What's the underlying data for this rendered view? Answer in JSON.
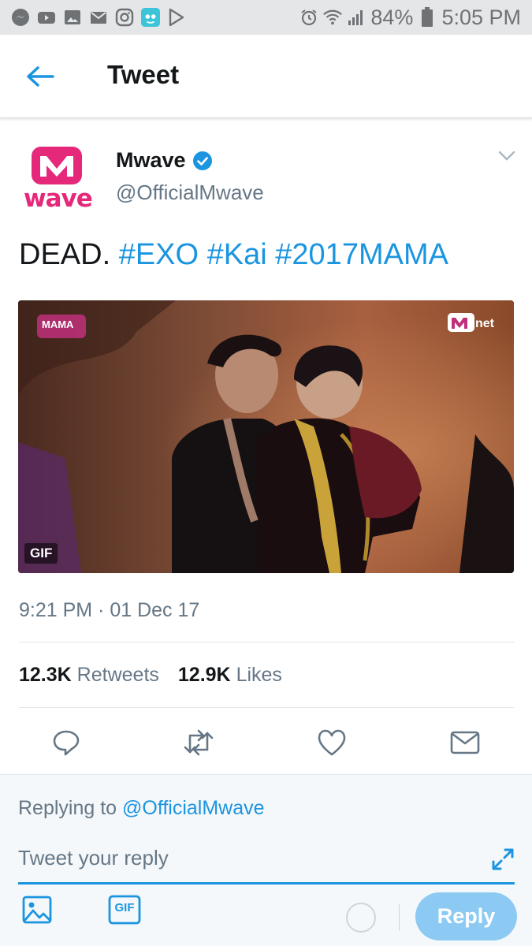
{
  "status_bar": {
    "battery": "84%",
    "time": "5:05 PM",
    "left_icons": [
      "messenger-icon",
      "youtube-icon",
      "gallery-icon",
      "mail-icon",
      "instagram-icon",
      "app-icon",
      "play-store-icon"
    ],
    "right_icons": [
      "alarm-icon",
      "wifi-icon",
      "signal-icon",
      "battery-icon"
    ]
  },
  "header": {
    "title": "Tweet",
    "back_icon": "back-arrow-icon"
  },
  "tweet": {
    "author_name": "Mwave",
    "author_handle": "@OfficialMwave",
    "avatar_text_top": "M",
    "avatar_text_bottom": "wave",
    "text_plain": "DEAD.",
    "hashtags": [
      "#EXO",
      "#Kai",
      "#2017MAMA"
    ],
    "media": {
      "badge": "GIF",
      "overlay_left": "MAMA",
      "overlay_right": "net"
    },
    "timestamp": "9:21 PM · 01 Dec 17",
    "retweets_count": "12.3K",
    "retweets_label": "Retweets",
    "likes_count": "12.9K",
    "likes_label": "Likes"
  },
  "actions": [
    "reply-icon",
    "retweet-icon",
    "like-icon",
    "direct-message-icon"
  ],
  "reply": {
    "replying_prefix": "Replying to",
    "replying_handle": "@OfficialMwave",
    "placeholder": "Tweet your reply",
    "button_label": "Reply",
    "gif_label": "GIF"
  },
  "colors": {
    "accent": "#1b95e0",
    "brand_mwave": "#e5287a",
    "reply_button": "#8ccaf3",
    "muted_text": "#657786"
  }
}
